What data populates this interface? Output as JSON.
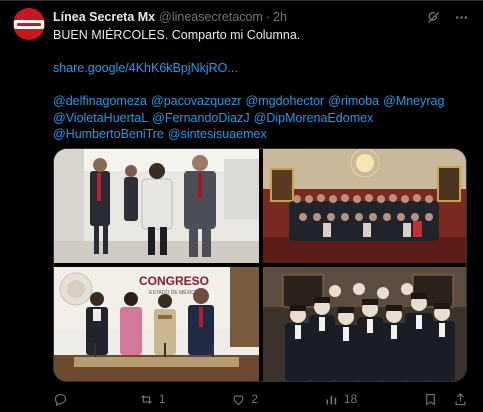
{
  "tweet": {
    "author_name": "Línea Secreta Mx",
    "handle": "@lineasecretacom",
    "separator": "·",
    "time": "2h",
    "text_line1": "BUEN MIÉRCOLES. Comparto mi Columna.",
    "link": "share.google/4KhK6kBpjNkjRO...",
    "mentions_line1": [
      "@delfinagomeza",
      "@pacovazquezr",
      "@mgdohector",
      "@rimoba",
      "@Mneyrag"
    ],
    "mentions_line2": [
      "@VioletaHuertaL",
      "@FernandoDiazJ",
      "@DipMorenaEdomex"
    ],
    "mentions_line3": [
      "@HumbertoBeniTre",
      "@sintesisuaemex"
    ]
  },
  "photos": {
    "p3_sign_title": "CONGRESO",
    "p3_sign_sub": "ESTADO DE MÉXICO"
  },
  "actions": {
    "reply_count": "",
    "retweet_count": "1",
    "like_count": "2",
    "views_count": "18"
  },
  "icons": {
    "top": [
      "grok-icon",
      "more-icon"
    ],
    "actions": [
      "reply-icon",
      "retweet-icon",
      "like-icon",
      "views-icon",
      "bookmark-icon"
    ]
  },
  "colors": {
    "background": "#000000",
    "text": "#e7e9ea",
    "muted": "#71767b",
    "link": "#1d9bf0",
    "avatar": "#c8161d"
  }
}
